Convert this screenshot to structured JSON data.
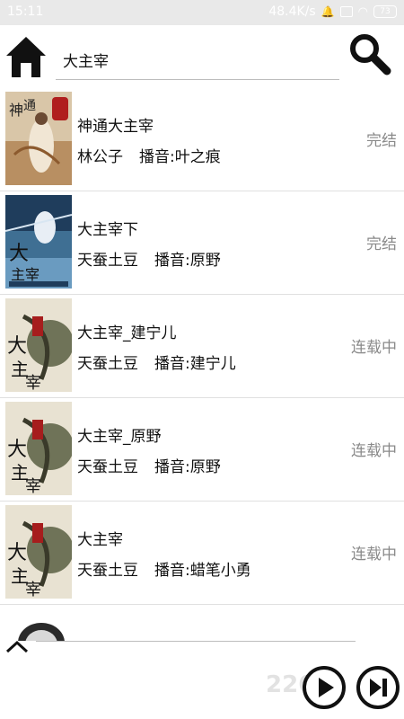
{
  "status_bar": {
    "time": "15:11",
    "network_speed": "48.4K/s",
    "battery": "73"
  },
  "search": {
    "value": "大主宰"
  },
  "books": [
    {
      "title": "神通大主宰",
      "author": "林公子",
      "narrator": "播音:叶之痕",
      "status": "完结"
    },
    {
      "title": "大主宰下",
      "author": "天蚕土豆",
      "narrator": "播音:原野",
      "status": "完结"
    },
    {
      "title": "大主宰_建宁儿",
      "author": "天蚕土豆",
      "narrator": "播音:建宁儿",
      "status": "连载中"
    },
    {
      "title": "大主宰_原野",
      "author": "天蚕土豆",
      "narrator": "播音:原野",
      "status": "连载中"
    },
    {
      "title": "大主宰",
      "author": "天蚕土豆",
      "narrator": "播音:蜡笔小勇",
      "status": "连载中"
    }
  ],
  "watermark": "2265",
  "colors": {
    "status_gray": "#8a8a8a",
    "divider": "#e0e0e0",
    "statusbar_bg": "#e9e9e9"
  }
}
